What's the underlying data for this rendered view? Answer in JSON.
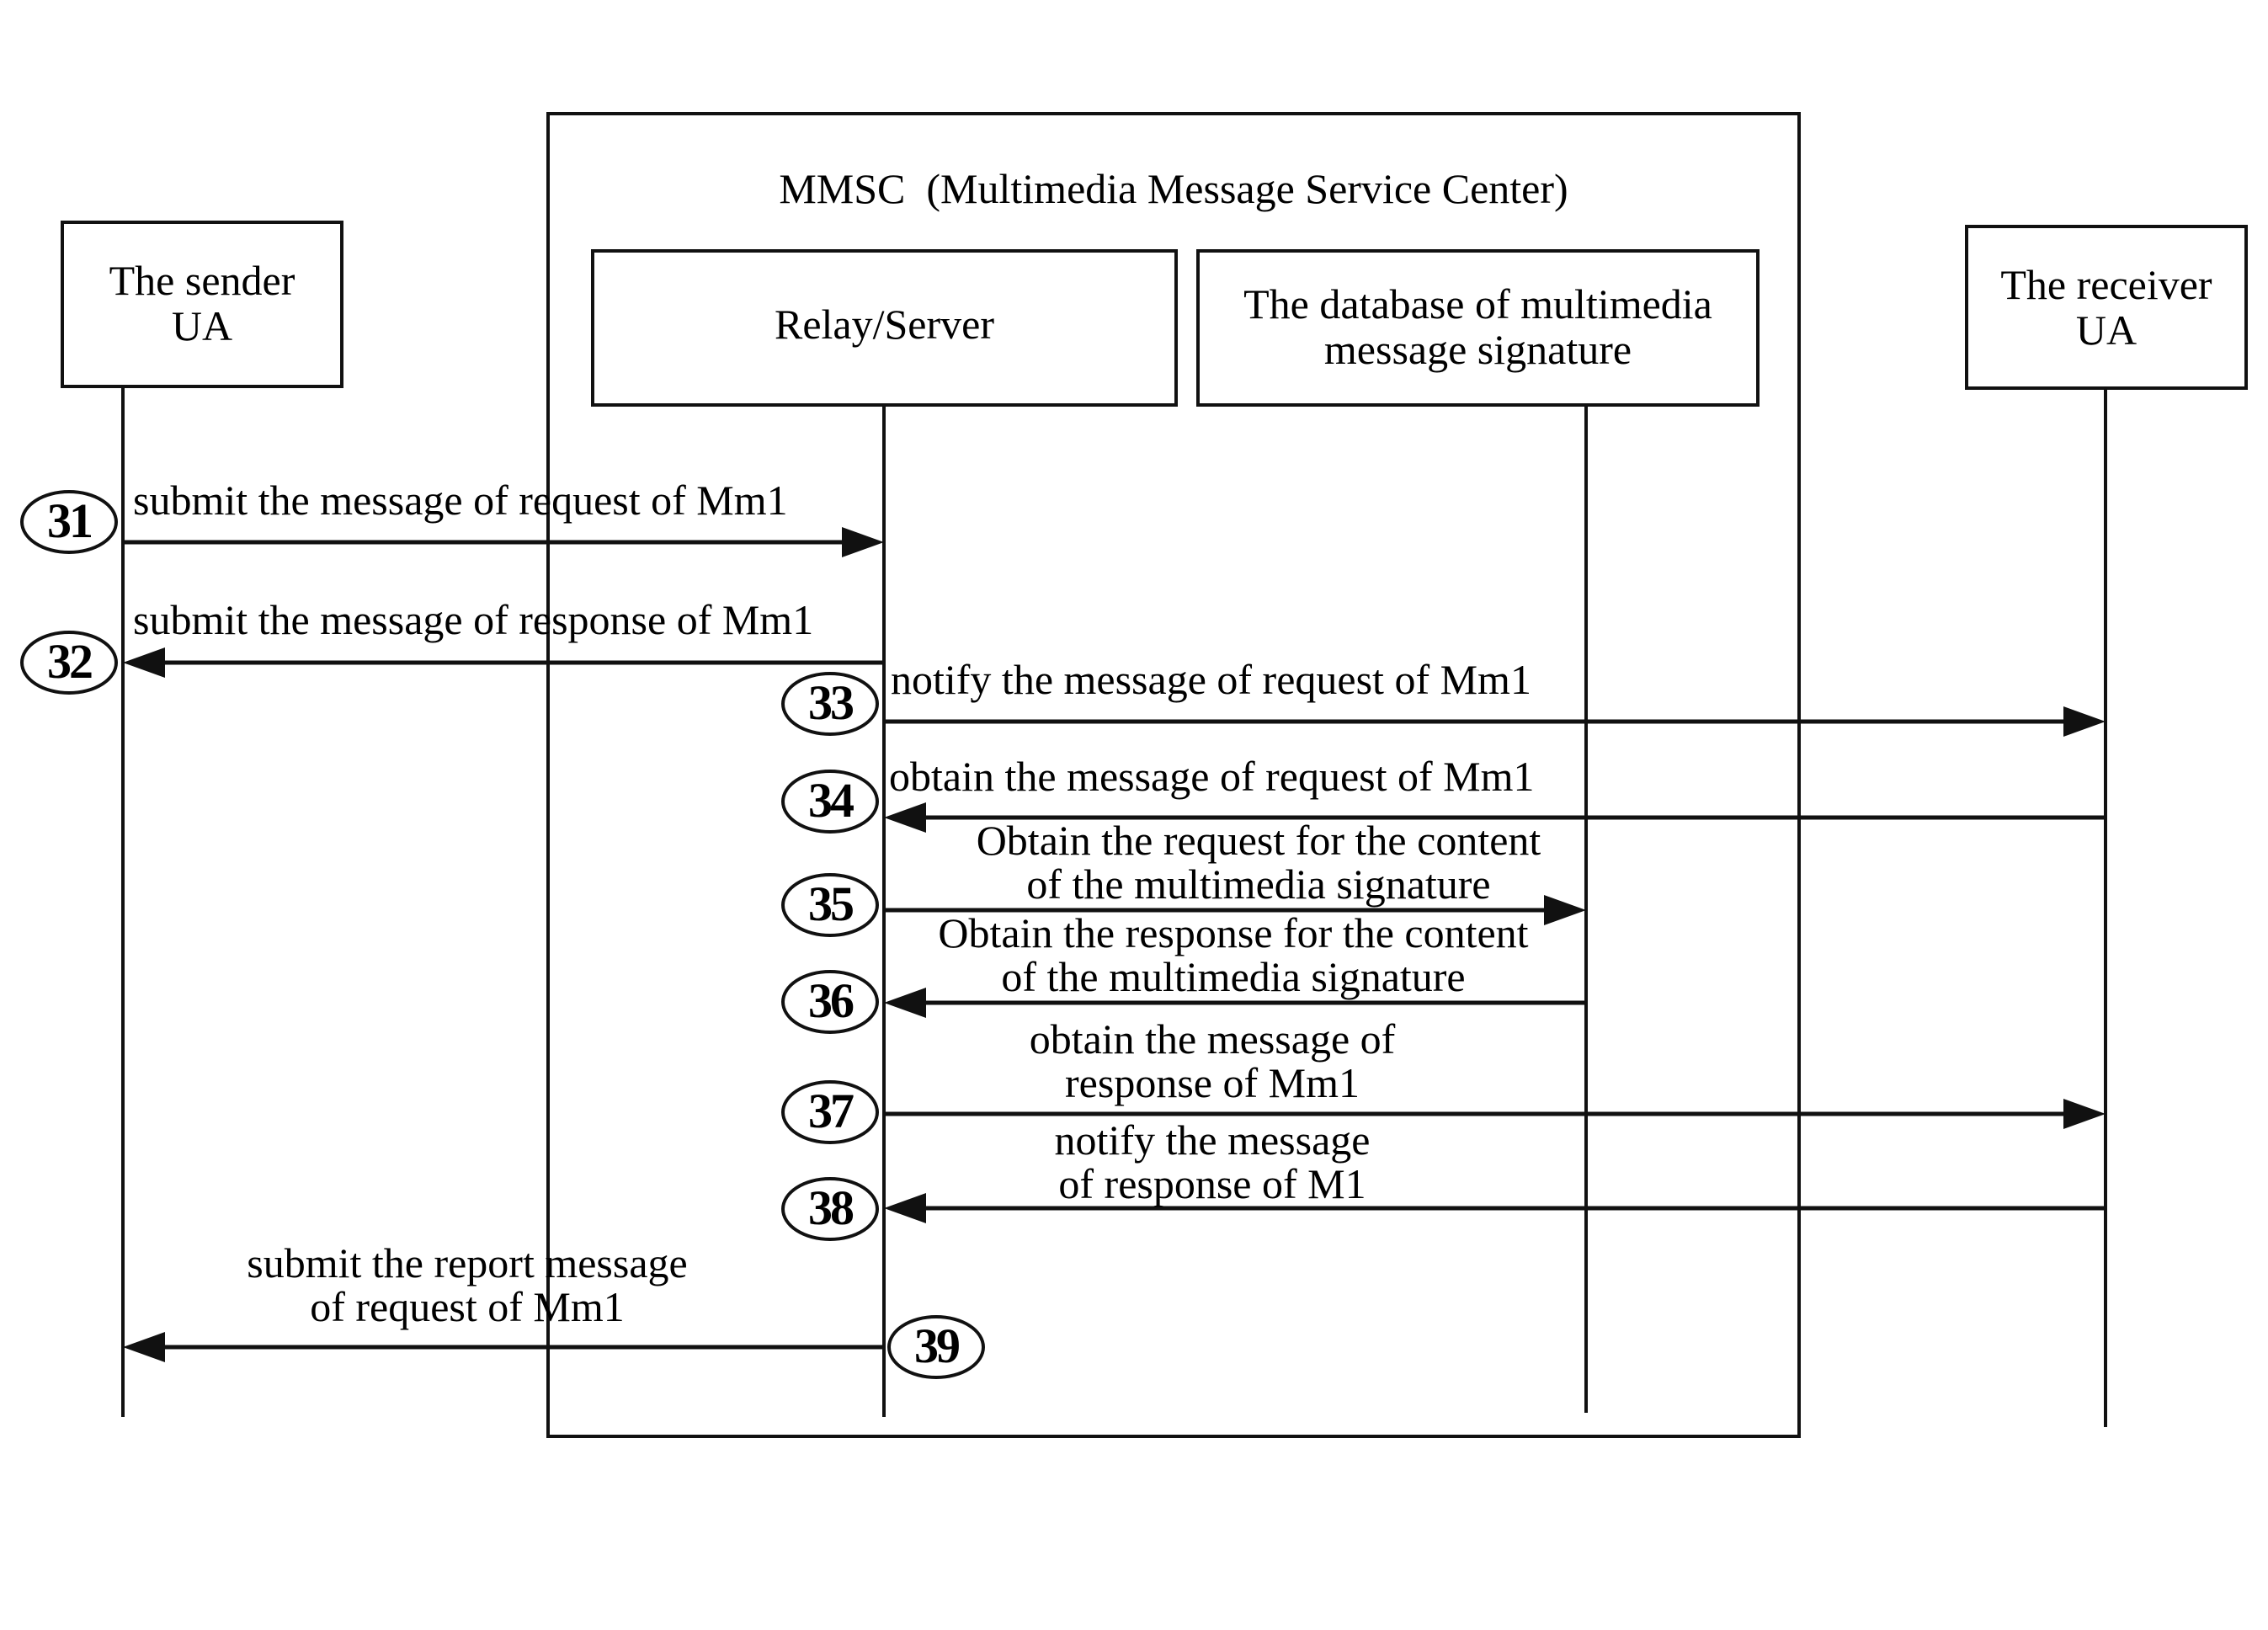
{
  "diagram": {
    "type": "sequence",
    "container": {
      "title": "MMSC  (Multimedia Message Service Center)"
    },
    "participants": [
      {
        "id": "sender",
        "label": "The sender\nUA"
      },
      {
        "id": "relay",
        "label": "Relay/Server"
      },
      {
        "id": "db",
        "label": "The database of multimedia\nmessage signature"
      },
      {
        "id": "receiver",
        "label": "The receiver\nUA"
      }
    ],
    "messages": [
      {
        "step": "31",
        "from": "sender",
        "to": "relay",
        "label": "submit the message of request of Mm1"
      },
      {
        "step": "32",
        "from": "relay",
        "to": "sender",
        "label": "submit the message of response of Mm1"
      },
      {
        "step": "33",
        "from": "relay",
        "to": "receiver",
        "label": "notify the message of request of Mm1"
      },
      {
        "step": "34",
        "from": "receiver",
        "to": "relay",
        "label": "obtain the message of request of Mm1"
      },
      {
        "step": "35",
        "from": "relay",
        "to": "db",
        "label": "Obtain the request for the content\nof the multimedia signature"
      },
      {
        "step": "36",
        "from": "db",
        "to": "relay",
        "label": "Obtain the response for the content\nof the multimedia signature"
      },
      {
        "step": "37",
        "from": "relay",
        "to": "receiver",
        "label": "obtain the message of\nresponse of Mm1"
      },
      {
        "step": "38",
        "from": "receiver",
        "to": "relay",
        "label": "notify the message\nof response of M1"
      },
      {
        "step": "39",
        "from": "relay",
        "to": "sender",
        "label": "submit the report message\nof request of Mm1"
      }
    ]
  }
}
